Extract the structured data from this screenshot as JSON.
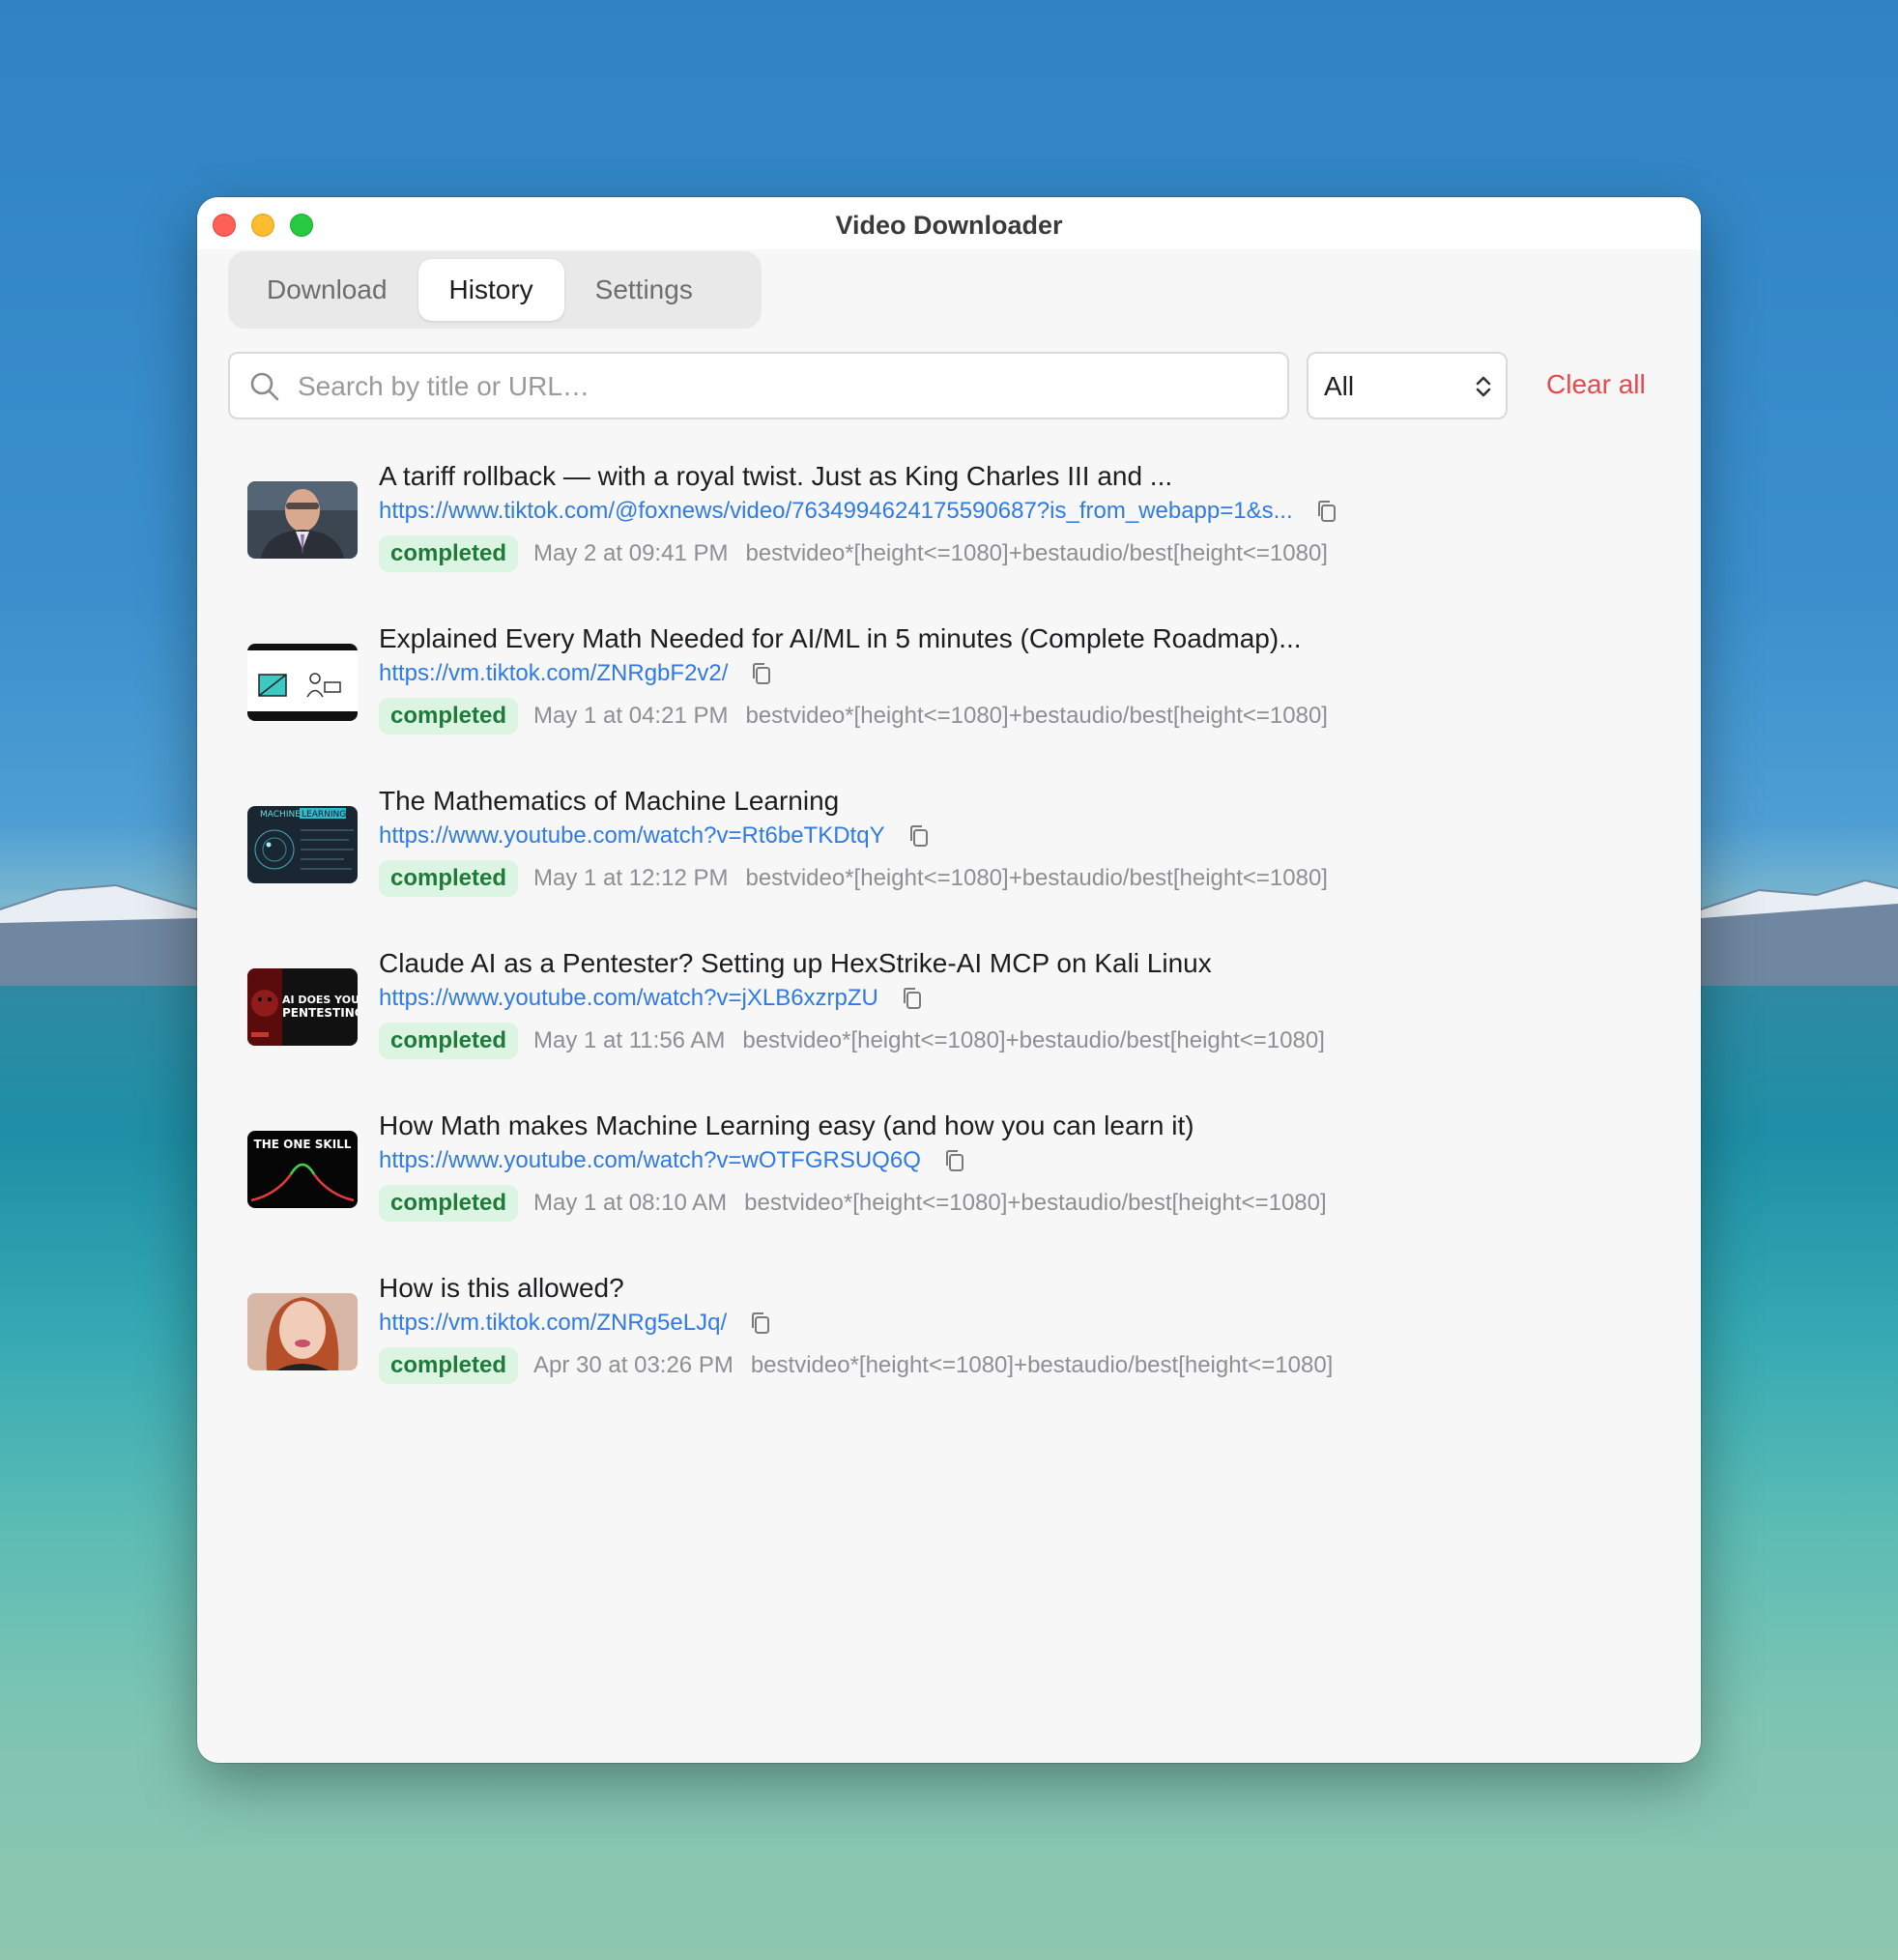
{
  "window": {
    "title": "Video Downloader"
  },
  "tabs": [
    {
      "label": "Download",
      "active": false
    },
    {
      "label": "History",
      "active": true
    },
    {
      "label": "Settings",
      "active": false
    }
  ],
  "search": {
    "placeholder": "Search by title or URL…",
    "value": ""
  },
  "filter": {
    "selected": "All"
  },
  "clear_label": "Clear all",
  "history": [
    {
      "title": "A tariff rollback — with a royal twist. Just as King Charles III and ...",
      "url": "https://www.tiktok.com/@foxnews/video/7634994624175590687?is_from_webapp=1&s...",
      "status": "completed",
      "date": "May 2 at 09:41 PM",
      "format": "bestvideo*[height<=1080]+bestaudio/best[height<=1080]",
      "thumb": "news-anchor"
    },
    {
      "title": "Explained Every Math Needed for AI/ML in 5 minutes (Complete Roadmap)...",
      "url": "https://vm.tiktok.com/ZNRgbF2v2/",
      "status": "completed",
      "date": "May 1 at 04:21 PM",
      "format": "bestvideo*[height<=1080]+bestaudio/best[height<=1080]",
      "thumb": "math-whiteboard"
    },
    {
      "title": "The Mathematics of Machine Learning",
      "url": "https://www.youtube.com/watch?v=Rt6beTKDtqY",
      "status": "completed",
      "date": "May 1 at 12:12 PM",
      "format": "bestvideo*[height<=1080]+bestaudio/best[height<=1080]",
      "thumb": "machine-learning",
      "thumb_text": [
        "MACHINE",
        "LEARNING"
      ]
    },
    {
      "title": "Claude AI as a Pentester?   Setting up HexStrike-AI MCP on Kali Linux",
      "url": "https://www.youtube.com/watch?v=jXLB6xzrpZU",
      "status": "completed",
      "date": "May 1 at 11:56 AM",
      "format": "bestvideo*[height<=1080]+bestaudio/best[height<=1080]",
      "thumb": "pentesting",
      "thumb_text": [
        "AI DOES YOUR",
        "PENTESTING"
      ]
    },
    {
      "title": "How Math makes Machine Learning easy (and how you can learn it)",
      "url": "https://www.youtube.com/watch?v=wOTFGRSUQ6Q",
      "status": "completed",
      "date": "May 1 at 08:10 AM",
      "format": "bestvideo*[height<=1080]+bestaudio/best[height<=1080]",
      "thumb": "one-skill",
      "thumb_text": [
        "THE ONE SKILL"
      ]
    },
    {
      "title": "How is this allowed?",
      "url": "https://vm.tiktok.com/ZNRg5eLJq/",
      "status": "completed",
      "date": "Apr 30 at 03:26 PM",
      "format": "bestvideo*[height<=1080]+bestaudio/best[height<=1080]",
      "thumb": "portrait"
    }
  ],
  "colors": {
    "link": "#2f7ae5",
    "badge_bg": "#dcf5e3",
    "badge_text": "#1e7a38",
    "danger": "#e5484d"
  }
}
